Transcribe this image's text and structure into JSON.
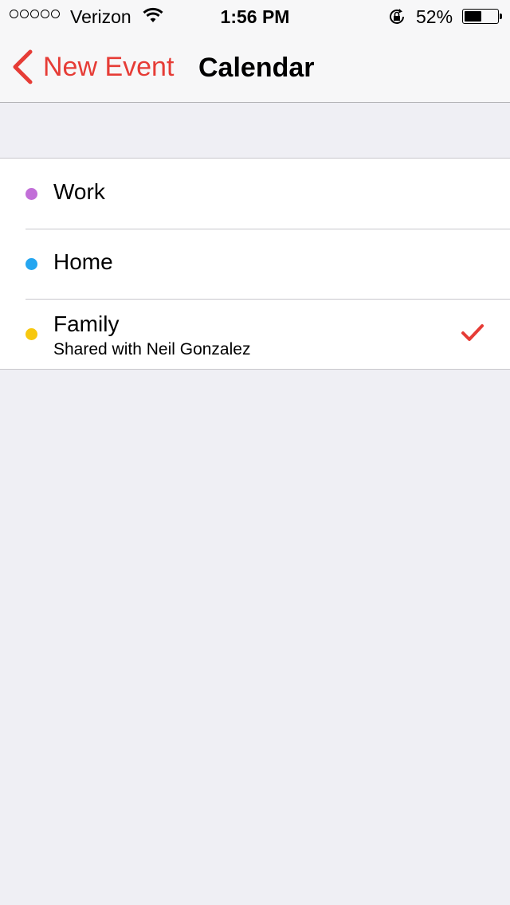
{
  "status_bar": {
    "carrier": "Verizon",
    "signal_bars_filled": 0,
    "signal_bars_total": 5,
    "time": "1:56 PM",
    "battery_text": "52%",
    "battery_level": 0.52,
    "icons": [
      "wifi-icon",
      "rotation-lock-icon",
      "battery-icon"
    ]
  },
  "nav": {
    "back_label": "New Event",
    "title": "Calendar",
    "accent_color": "#e63c36"
  },
  "calendars": [
    {
      "name": "Work",
      "color": "#c26fd8",
      "subtitle": null,
      "selected": false
    },
    {
      "name": "Home",
      "color": "#25a6f0",
      "subtitle": null,
      "selected": false
    },
    {
      "name": "Family",
      "color": "#f7c80f",
      "subtitle": "Shared with Neil Gonzalez",
      "selected": true
    }
  ]
}
